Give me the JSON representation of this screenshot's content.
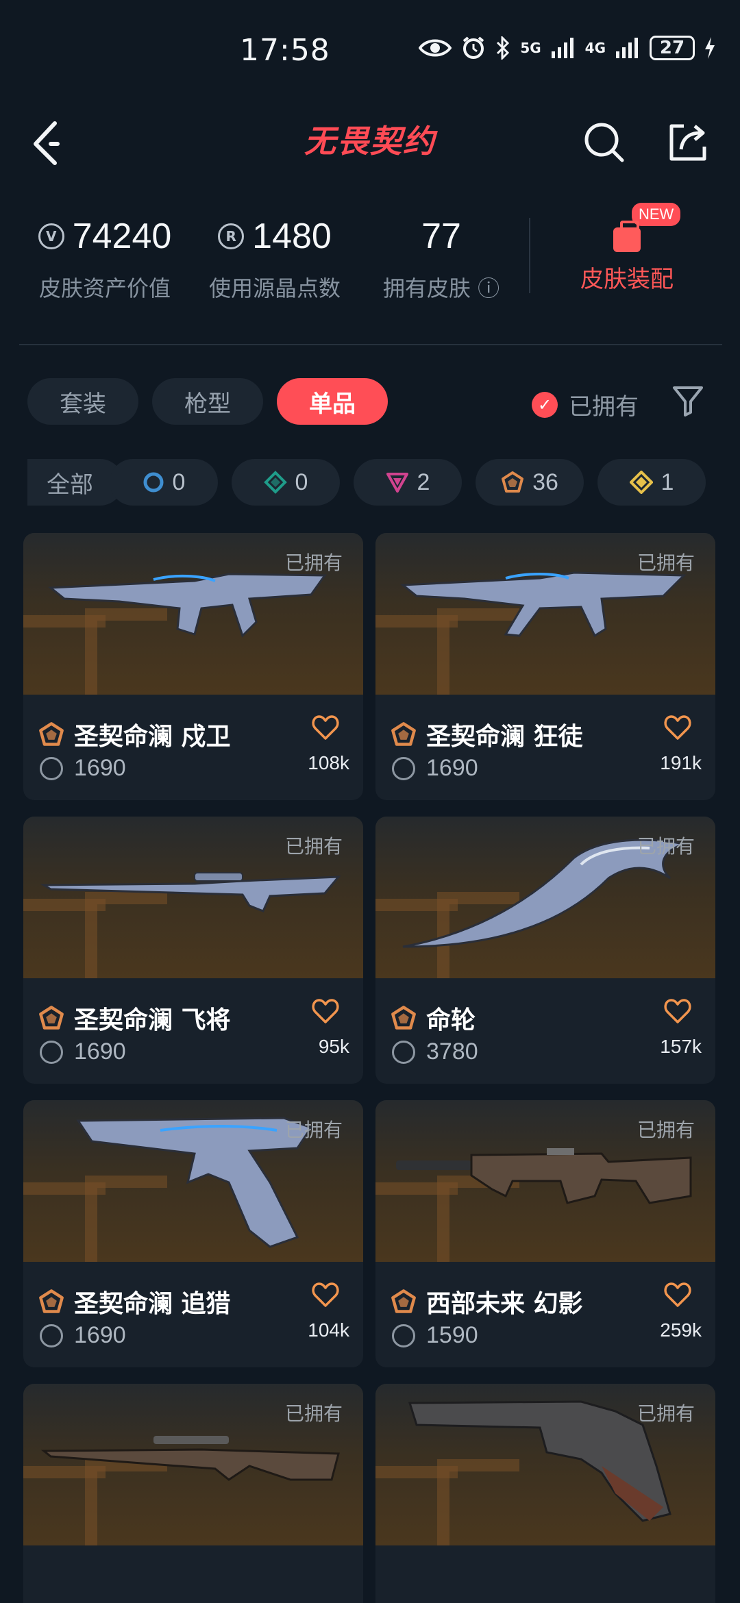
{
  "status": {
    "time": "17:58",
    "network1": "5G",
    "network2": "4G",
    "battery": "27"
  },
  "header": {
    "logo_text": "无畏契约"
  },
  "stats": [
    {
      "value": "74240",
      "label": "皮肤资产价值",
      "icon": "vp-coin-icon"
    },
    {
      "value": "1480",
      "label": "使用源晶点数",
      "icon": "radianite-icon"
    },
    {
      "value": "77",
      "label": "拥有皮肤 ⓘ"
    }
  ],
  "loadout": {
    "label": "皮肤装配",
    "badge": "NEW"
  },
  "tabs": [
    "套装",
    "枪型",
    "单品"
  ],
  "active_tab": "单品",
  "owned_filter": {
    "label": "已拥有",
    "checked": true
  },
  "chips": [
    {
      "label": "全部"
    },
    {
      "count": "0",
      "icon": "select-tier-icon",
      "color": "#3f8ed0"
    },
    {
      "count": "0",
      "icon": "deluxe-tier-icon",
      "color": "#1f9c8a"
    },
    {
      "count": "2",
      "icon": "premium-tier-icon",
      "color": "#d1438f"
    },
    {
      "count": "36",
      "icon": "ultra-tier-icon",
      "color": "#e08a4c"
    },
    {
      "count": "1",
      "icon": "exclusive-tier-icon",
      "color": "#e6c04a"
    }
  ],
  "cards": [
    {
      "title": "圣契命澜 戍卫",
      "price": "1690",
      "likes": "108k",
      "owned": "已拥有"
    },
    {
      "title": "圣契命澜 狂徒",
      "price": "1690",
      "likes": "191k",
      "owned": "已拥有"
    },
    {
      "title": "圣契命澜 飞将",
      "price": "1690",
      "likes": "95k",
      "owned": "已拥有"
    },
    {
      "title": "命轮",
      "price": "3780",
      "likes": "157k",
      "owned": "已拥有"
    },
    {
      "title": "圣契命澜 追猎",
      "price": "1690",
      "likes": "104k",
      "owned": "已拥有"
    },
    {
      "title": "西部未来 幻影",
      "price": "1590",
      "likes": "259k",
      "owned": "已拥有"
    },
    {
      "title": "",
      "price": "",
      "likes": "",
      "owned": "已拥有"
    },
    {
      "title": "",
      "price": "",
      "likes": "",
      "owned": "已拥有"
    }
  ],
  "colors": {
    "accent": "#ff4e56",
    "background": "#0f1822",
    "card": "#18212b"
  }
}
